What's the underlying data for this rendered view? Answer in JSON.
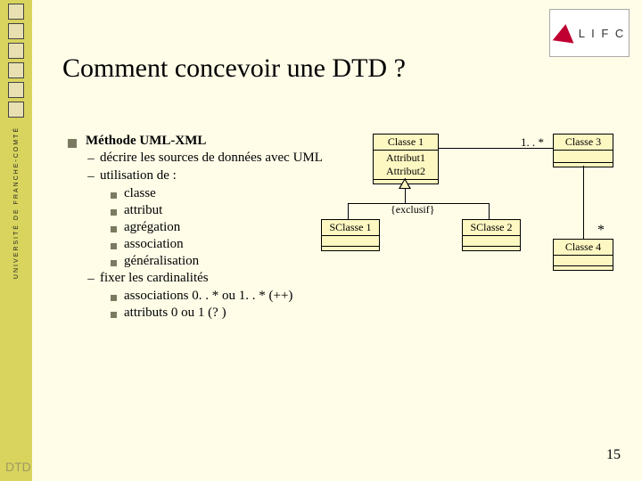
{
  "sidebar": {
    "org_text": "UNIVERSITÉ DE FRANCHE-COMTÉ"
  },
  "logo": {
    "text": "L I F C"
  },
  "title": "Comment concevoir une DTD ?",
  "bullets": {
    "method": "Méthode UML-XML",
    "sub1": "décrire les sources de données avec UML",
    "sub2": "utilisation de :",
    "sub2_items": [
      "classe",
      "attribut",
      "agrégation",
      "association",
      "généralisation"
    ],
    "sub3": "fixer les cardinalités",
    "sub3_items": [
      "associations 0. . * ou 1. . * (++)",
      "attributs 0 ou 1 (? )"
    ]
  },
  "uml": {
    "classe1": {
      "name": "Classe 1",
      "attrs": [
        "Attribut1",
        "Attribut2"
      ]
    },
    "classe3": {
      "name": "Classe 3"
    },
    "sclasse1": {
      "name": "SClasse 1"
    },
    "sclasse2": {
      "name": "SClasse 2"
    },
    "classe4": {
      "name": "Classe 4"
    },
    "assoc_c1_c3": "1. . *",
    "assoc_c3_c4": "*",
    "exclusif": "{exclusif}"
  },
  "footer": {
    "left": "DTD",
    "page": "15"
  }
}
